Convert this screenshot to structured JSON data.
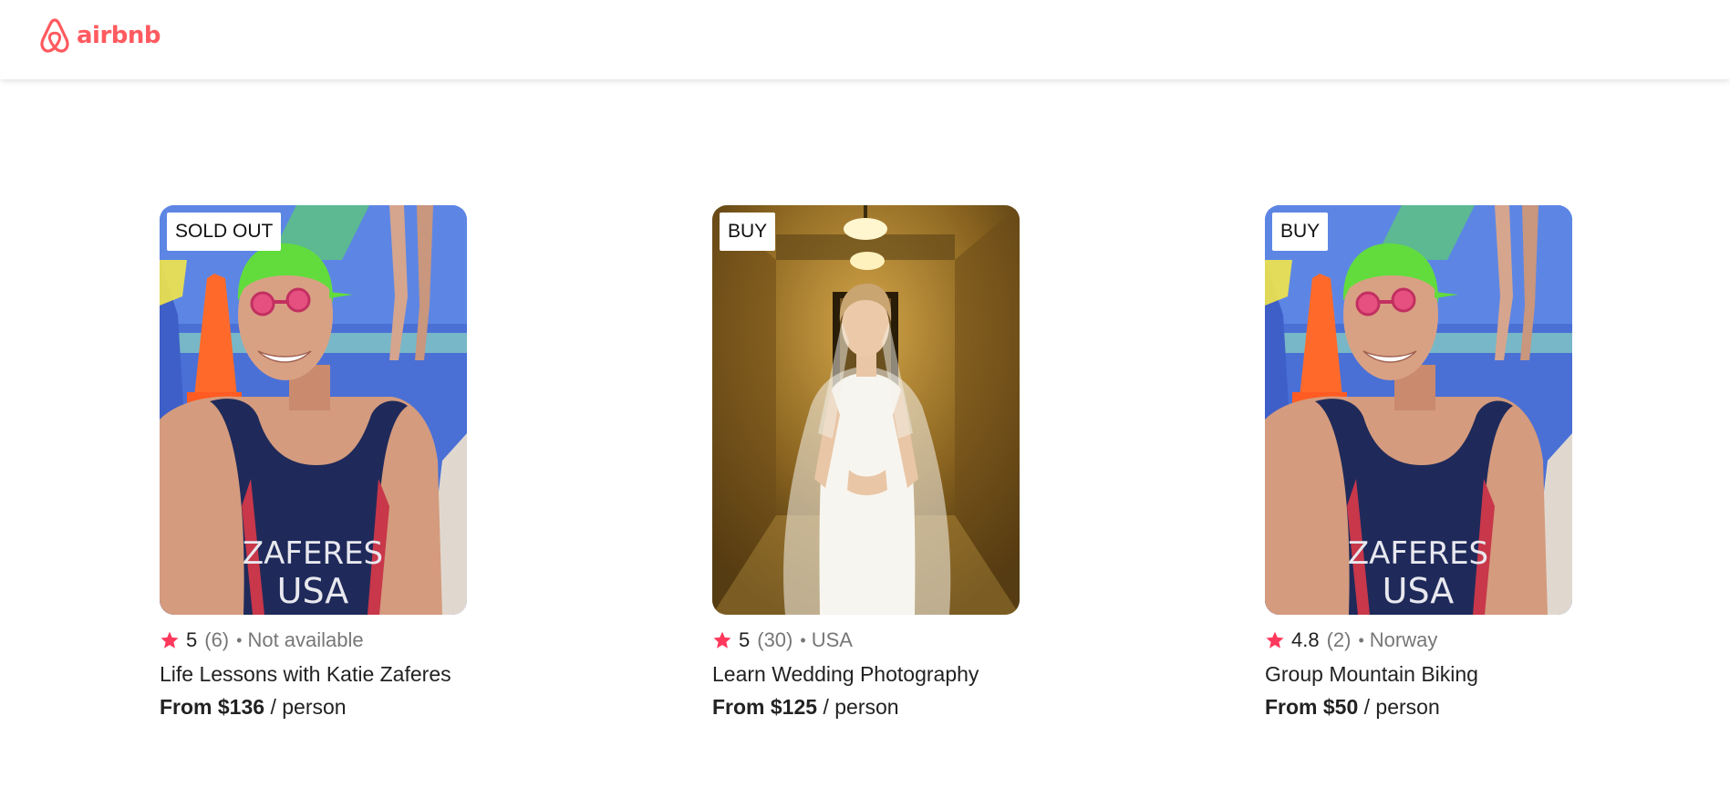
{
  "brand": {
    "name": "airbnb",
    "color": "#ff5a5f"
  },
  "colors": {
    "star": "#ff385c",
    "muted_text": "#777777",
    "text": "#222222"
  },
  "cards": [
    {
      "badge": "SOLD OUT",
      "rating": "5",
      "review_count": "(6)",
      "separator": "•",
      "location": "Not available",
      "title": "Life Lessons with Katie Zaferes",
      "price_from": "From $136",
      "price_unit": "/ person",
      "image_kind": "triathlete",
      "jersey_line1": "ZAFERES",
      "jersey_line2": "USA"
    },
    {
      "badge": "BUY",
      "rating": "5",
      "review_count": "(30)",
      "separator": "•",
      "location": "USA",
      "title": "Learn Wedding Photography",
      "price_from": "From $125",
      "price_unit": "/ person",
      "image_kind": "bride"
    },
    {
      "badge": "BUY",
      "rating": "4.8",
      "review_count": "(2)",
      "separator": "•",
      "location": "Norway",
      "title": "Group Mountain Biking",
      "price_from": "From $50",
      "price_unit": "/ person",
      "image_kind": "triathlete",
      "jersey_line1": "ZAFERES",
      "jersey_line2": "USA"
    }
  ]
}
